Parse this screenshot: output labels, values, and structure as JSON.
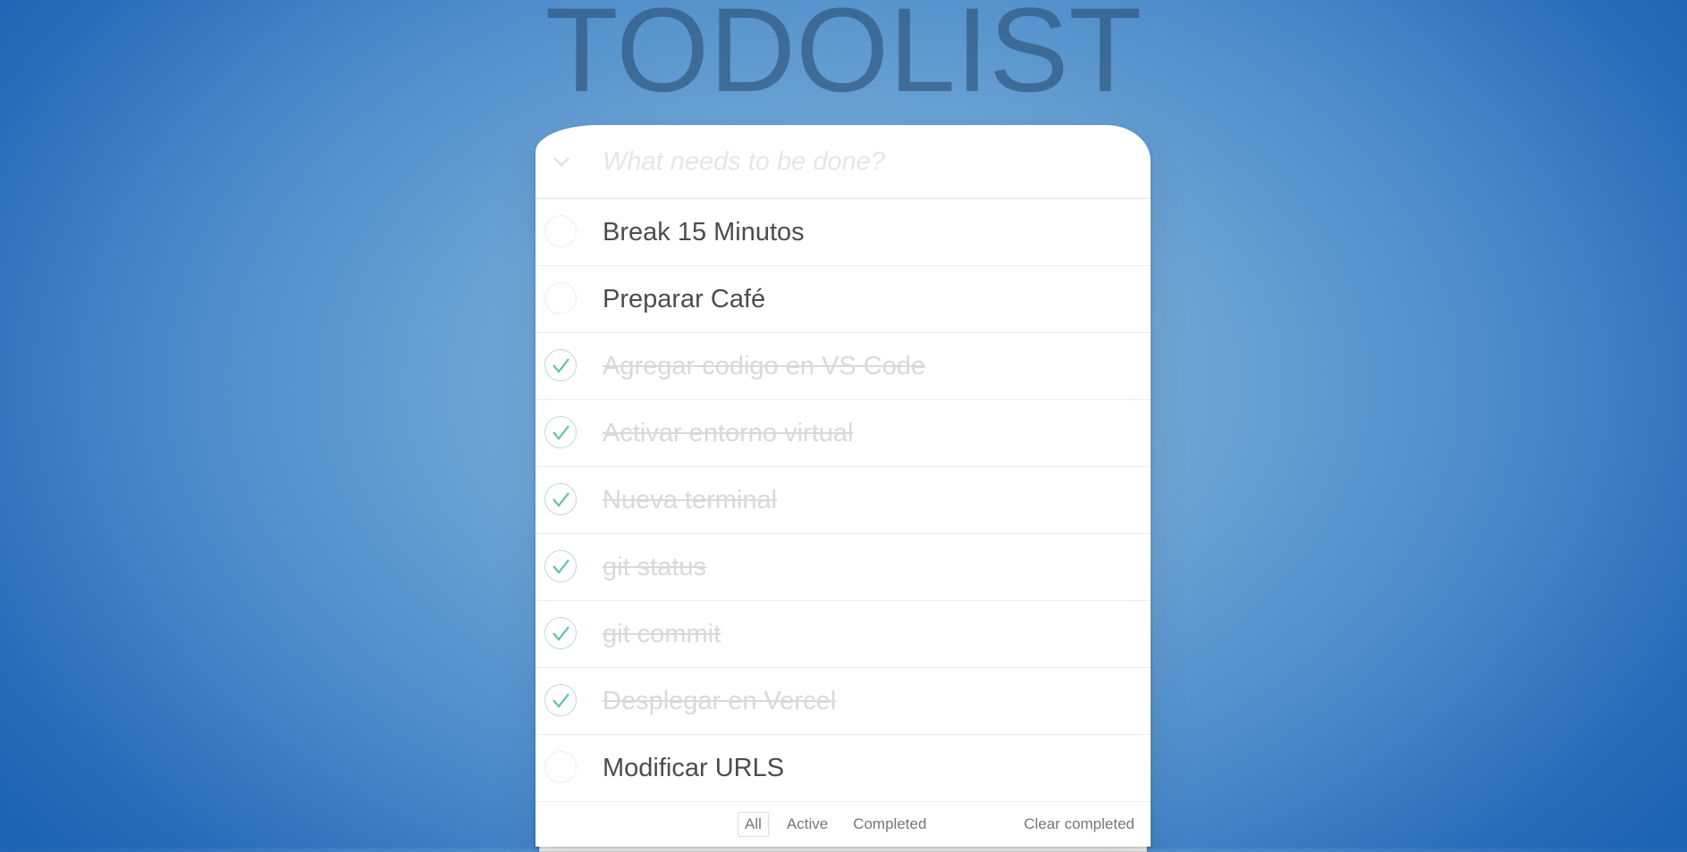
{
  "app": {
    "title": "TODOLIST"
  },
  "new_todo": {
    "placeholder": "What needs to be done?",
    "value": ""
  },
  "todos": [
    {
      "label": "Break 15 Minutos",
      "completed": false
    },
    {
      "label": "Preparar Café",
      "completed": false
    },
    {
      "label": "Agregar codigo en VS Code",
      "completed": true
    },
    {
      "label": "Activar entorno virtual",
      "completed": true
    },
    {
      "label": "Nueva terminal",
      "completed": true
    },
    {
      "label": "git status",
      "completed": true
    },
    {
      "label": "git commit",
      "completed": true
    },
    {
      "label": "Desplegar en Vercel",
      "completed": true
    },
    {
      "label": "Modificar URLS",
      "completed": false
    }
  ],
  "footer": {
    "filters": [
      {
        "label": "All",
        "selected": true
      },
      {
        "label": "Active",
        "selected": false
      },
      {
        "label": "Completed",
        "selected": false
      }
    ],
    "clear_completed_label": "Clear completed"
  },
  "colors": {
    "check_green": "#5dc2af",
    "completed_text": "#d9d9d9",
    "active_text": "#4d4d4d",
    "selected_filter_border": "#efd5d5"
  }
}
